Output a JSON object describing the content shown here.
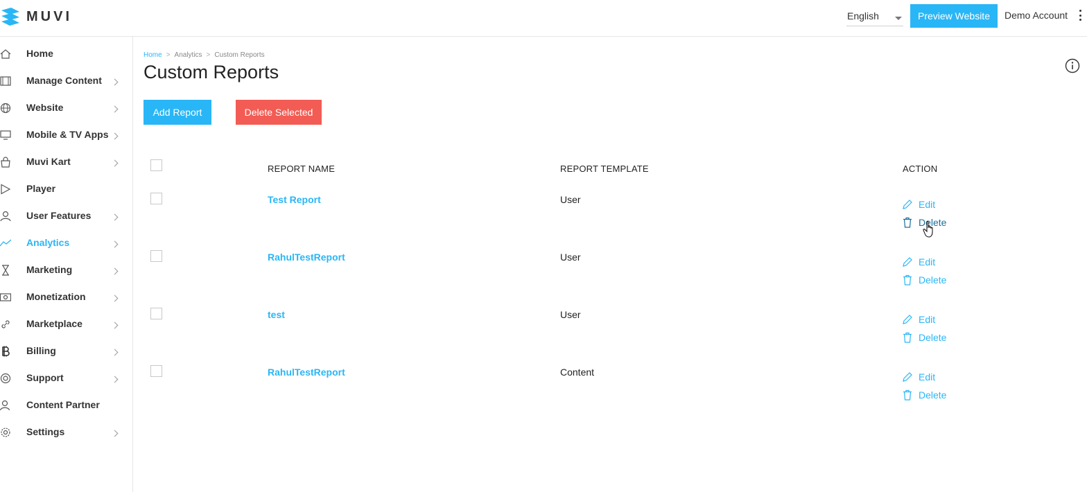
{
  "header": {
    "logo_text": "MUVI",
    "language": "English",
    "preview_label": "Preview Website",
    "account_label": "Demo Account"
  },
  "sidebar": {
    "items": [
      {
        "label": "Home",
        "icon": "home-icon",
        "chevron": false
      },
      {
        "label": "Manage Content",
        "icon": "film-icon",
        "chevron": true
      },
      {
        "label": "Website",
        "icon": "globe-icon",
        "chevron": true
      },
      {
        "label": "Mobile & TV Apps",
        "icon": "monitor-icon",
        "chevron": true
      },
      {
        "label": "Muvi Kart",
        "icon": "shopping-bag-icon",
        "chevron": true
      },
      {
        "label": "Player",
        "icon": "play-icon",
        "chevron": false
      },
      {
        "label": "User Features",
        "icon": "user-icon",
        "chevron": true
      },
      {
        "label": "Analytics",
        "icon": "trend-line-icon",
        "chevron": true,
        "active": true
      },
      {
        "label": "Marketing",
        "icon": "hourglass-icon",
        "chevron": true
      },
      {
        "label": "Monetization",
        "icon": "money-icon",
        "chevron": true
      },
      {
        "label": "Marketplace",
        "icon": "link-icon",
        "chevron": true
      },
      {
        "label": "Billing",
        "icon": "bitcoin-icon",
        "chevron": true
      },
      {
        "label": "Support",
        "icon": "lifebuoy-icon",
        "chevron": true
      },
      {
        "label": "Content Partner",
        "icon": "users-icon",
        "chevron": false
      },
      {
        "label": "Settings",
        "icon": "gear-icon",
        "chevron": true
      }
    ]
  },
  "breadcrumb": {
    "home": "Home",
    "separator": ">",
    "analytics": "Analytics",
    "current": "Custom Reports"
  },
  "page": {
    "title": "Custom Reports",
    "add_label": "Add Report",
    "delete_selected_label": "Delete Selected"
  },
  "table": {
    "headers": {
      "name": "REPORT NAME",
      "template": "REPORT TEMPLATE",
      "action": "ACTION"
    },
    "edit_label": "Edit",
    "delete_label": "Delete",
    "rows": [
      {
        "name": "Test Report",
        "template": "User"
      },
      {
        "name": "RahulTestReport",
        "template": "User"
      },
      {
        "name": "test",
        "template": "User"
      },
      {
        "name": "RahulTestReport",
        "template": "Content"
      }
    ]
  },
  "colors": {
    "accent": "#29b6f6",
    "danger": "#f25c54",
    "text": "#222222"
  }
}
